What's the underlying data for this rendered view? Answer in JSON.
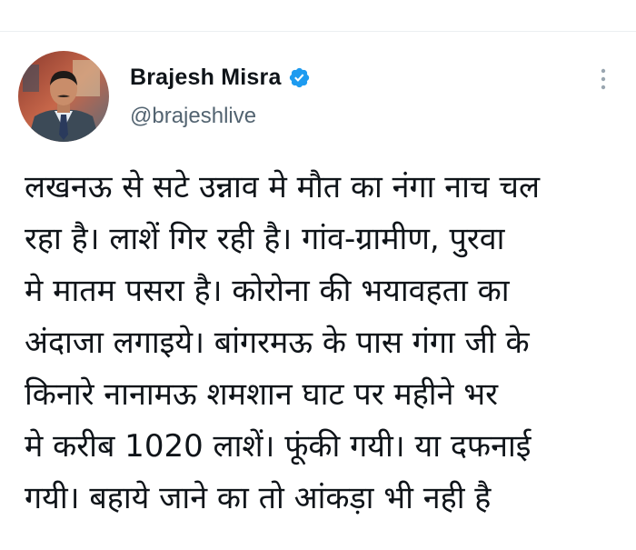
{
  "tweet": {
    "author": {
      "display_name": "Brajesh Misra",
      "handle": "@brajeshlive",
      "verified": true,
      "avatar_icon": "profile-photo"
    },
    "more_icon": "more-options-icon",
    "body_lines": [
      "लखनऊ से सटे उन्नाव मे मौत का नंगा नाच चल",
      "रहा है। लाशें गिर रही है। गांव-ग्रामीण, पुरवा",
      "मे मातम पसरा है। कोरोना की भयावहता का",
      "अंदाजा लगाइये। बांगरमऊ के पास गंगा जी के",
      "किनारे नानामऊ शमशान घाट पर महीने भर",
      "मे करीब 1020 लाशें। फूंकी गयी। या दफनाई",
      "गयी। बहाये जाने का तो आंकड़ा भी नही है"
    ]
  },
  "colors": {
    "text_primary": "#0f1419",
    "text_secondary": "#536471",
    "verified_blue": "#1d9bf0",
    "divider": "#eceff1"
  }
}
